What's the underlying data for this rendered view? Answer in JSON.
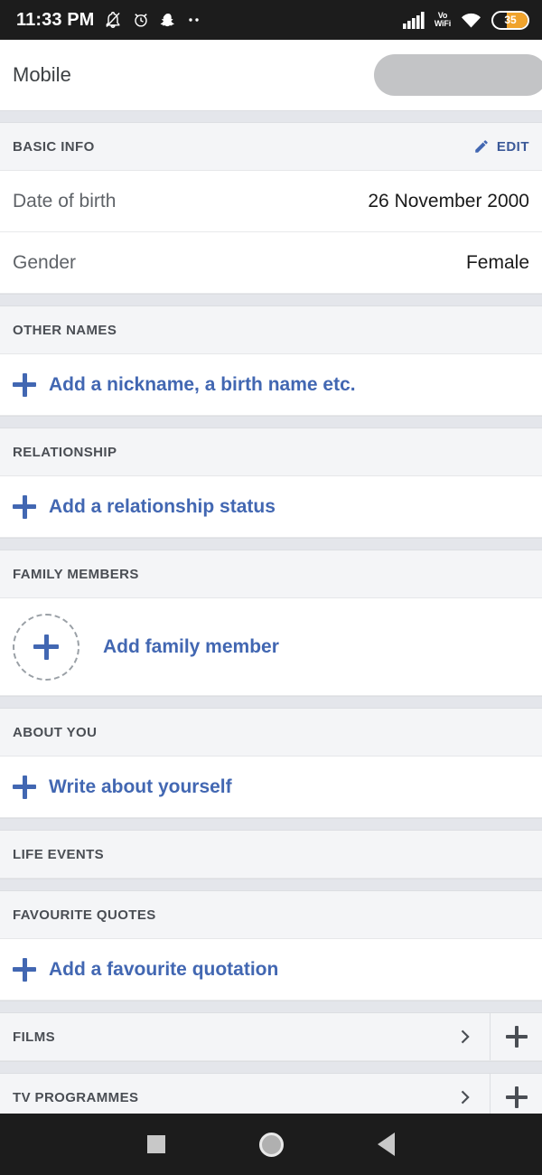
{
  "status_bar": {
    "time": "11:33 PM",
    "left_icons": [
      "notifications-silenced-icon",
      "alarm-icon",
      "snapchat-icon",
      "more-notifications-icon"
    ],
    "vowifi_line1": "Vo",
    "vowifi_line2": "WiFi",
    "right_icons": [
      "cellular-signal-icon",
      "vowifi-icon",
      "wifi-icon",
      "battery-icon"
    ],
    "battery_level": "35",
    "battery_color": "#f0a32c",
    "background_color": "#1c1c1c"
  },
  "contact": {
    "label": "Mobile",
    "value_redacted": true
  },
  "basic_info": {
    "title": "BASIC INFO",
    "edit_label": "EDIT",
    "rows": [
      {
        "label": "Date of birth",
        "value": "26 November 2000"
      },
      {
        "label": "Gender",
        "value": "Female"
      }
    ]
  },
  "other_names": {
    "title": "OTHER NAMES",
    "add_label": "Add a nickname, a birth name etc."
  },
  "relationship": {
    "title": "RELATIONSHIP",
    "add_label": "Add a relationship status"
  },
  "family_members": {
    "title": "FAMILY MEMBERS",
    "add_label": "Add family member"
  },
  "about_you": {
    "title": "ABOUT YOU",
    "add_label": "Write about yourself"
  },
  "life_events": {
    "title": "LIFE EVENTS"
  },
  "favourite_quotes": {
    "title": "FAVOURITE QUOTES",
    "add_label": "Add a favourite quotation"
  },
  "categories": [
    {
      "title": "FILMS"
    },
    {
      "title": "TV PROGRAMMES"
    }
  ],
  "nav_bar": {
    "items": [
      "recents-square-icon",
      "home-circle-icon",
      "back-triangle-icon"
    ]
  },
  "colors": {
    "accent_blue": "#4267b2",
    "edit_blue": "#3b5998",
    "section_bg": "#f4f5f7",
    "band_gray": "#e4e6eb",
    "value_text": "#1a1a1a",
    "label_text": "#5f6368"
  }
}
